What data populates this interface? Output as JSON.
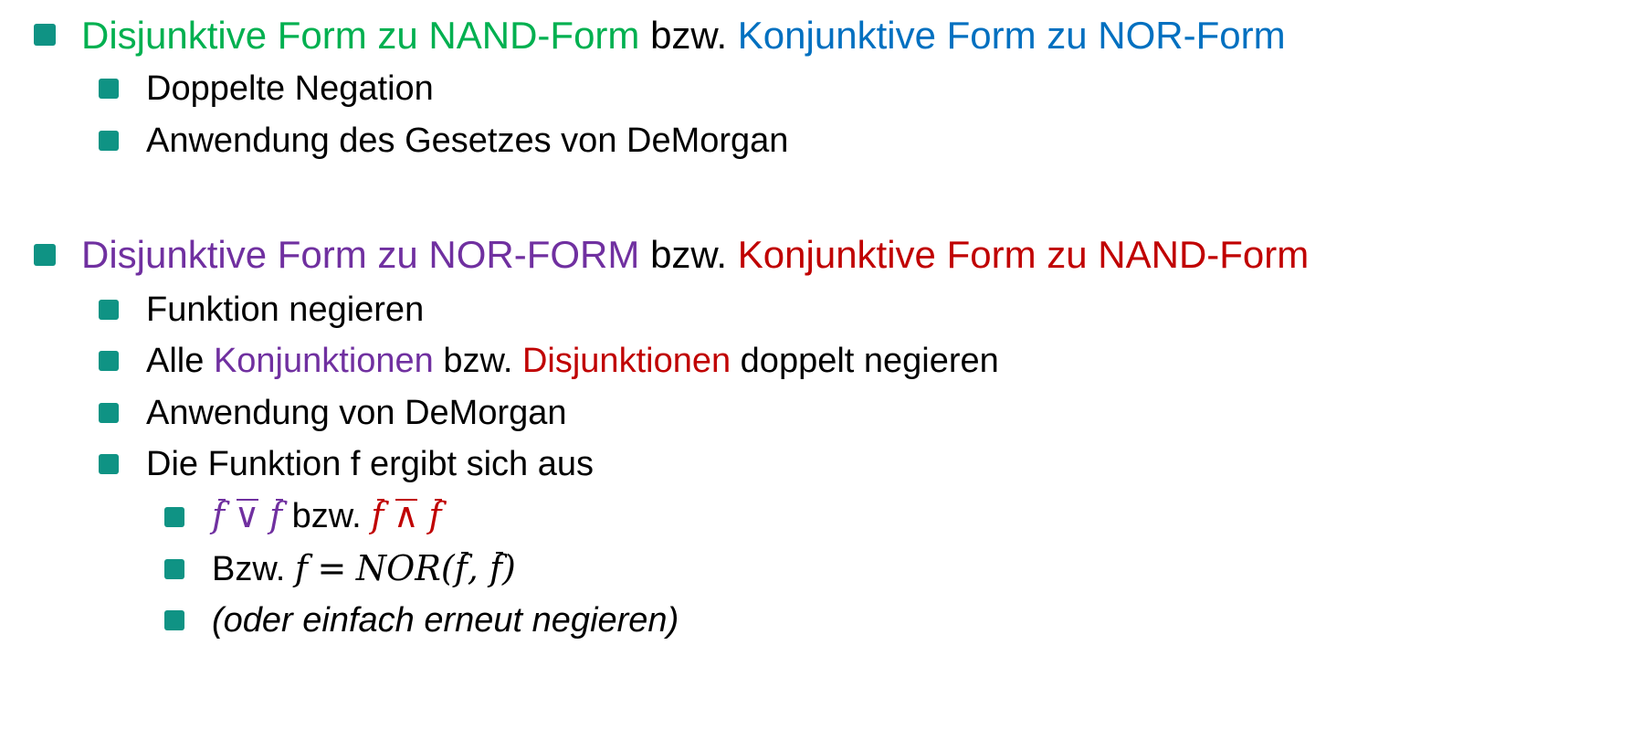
{
  "section1": {
    "heading_a": "Disjunktive Form zu NAND-Form",
    "heading_sep": "bzw.",
    "heading_b": "Konjunktive Form zu NOR-Form",
    "items": [
      "Doppelte Negation",
      "Anwendung des Gesetzes von DeMorgan"
    ]
  },
  "section2": {
    "heading_a": "Disjunktive Form zu NOR-FORM",
    "heading_sep": "bzw.",
    "heading_b": "Konjunktive Form zu NAND-Form",
    "item1": "Funktion negieren",
    "item2": {
      "pre": "Alle",
      "purple": "Konjunktionen",
      "mid": "bzw.",
      "red": "Disjunktionen",
      "post": "doppelt negieren"
    },
    "item3": "Anwendung von DeMorgan",
    "item4": "Die Funktion f ergibt sich aus",
    "sub": {
      "formula1": {
        "f": "f",
        "or_op": "∨",
        "sep": "bzw.",
        "and_op": "∧"
      },
      "formula2": {
        "prefix": "Bzw.",
        "lhs": "f",
        "eq": "=",
        "fn": "NOR(",
        "arg": "f",
        "comma": ",",
        "close": ")"
      },
      "note": "(oder einfach erneut negieren)"
    }
  },
  "colors": {
    "bullet": "#0f9384",
    "green": "#00b050",
    "blue": "#0070c0",
    "purple": "#7030a0",
    "red": "#c00000"
  }
}
